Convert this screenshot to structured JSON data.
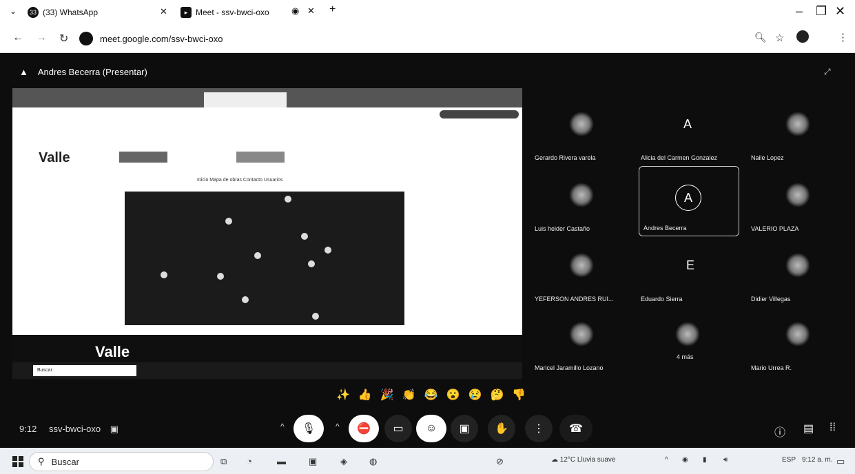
{
  "browser": {
    "tabs": [
      {
        "label": "(33) WhatsApp",
        "badge": "33"
      },
      {
        "label": "Meet - ssv-bwci-oxo"
      }
    ],
    "url": "meet.google.com/ssv-bwci-oxo"
  },
  "meet": {
    "presenter_label": "Andres Becerra (Presentar)",
    "time": "9:12",
    "meeting_code": "ssv-bwci-oxo",
    "shared_screen": {
      "logo_text": "Valle",
      "logo_text_bottom": "Valle",
      "nav_links": "Inicio   Mapa de obras   Contacto   Usuarios",
      "taskbar_search": "Buscar"
    },
    "participants": [
      {
        "name": "Gerardo Rivera varela",
        "avatar": "img"
      },
      {
        "name": "Alicia del Carmen Gonzalez",
        "avatar": "A"
      },
      {
        "name": "Naile Lopez",
        "avatar": "img"
      },
      {
        "name": "Luis heider Castaño",
        "avatar": "img"
      },
      {
        "name": "Andres Becerra",
        "avatar": "A"
      },
      {
        "name": "VALERIO PLAZA",
        "avatar": "img"
      },
      {
        "name": "YEFERSON ANDRES RUI...",
        "avatar": "img"
      },
      {
        "name": "Eduardo Sierra",
        "avatar": "E"
      },
      {
        "name": "Didier Villegas",
        "avatar": "img"
      },
      {
        "name": "Maricel Jaramillo Lozano",
        "avatar": "img"
      },
      {
        "name": "4 más",
        "avatar": "img"
      },
      {
        "name": "Mario Urrea R.",
        "avatar": "img"
      }
    ]
  },
  "taskbar": {
    "search_placeholder": "Buscar",
    "weather": "12°C  Lluvia suave",
    "lang": "ESP",
    "clock": "9:12 a. m."
  }
}
